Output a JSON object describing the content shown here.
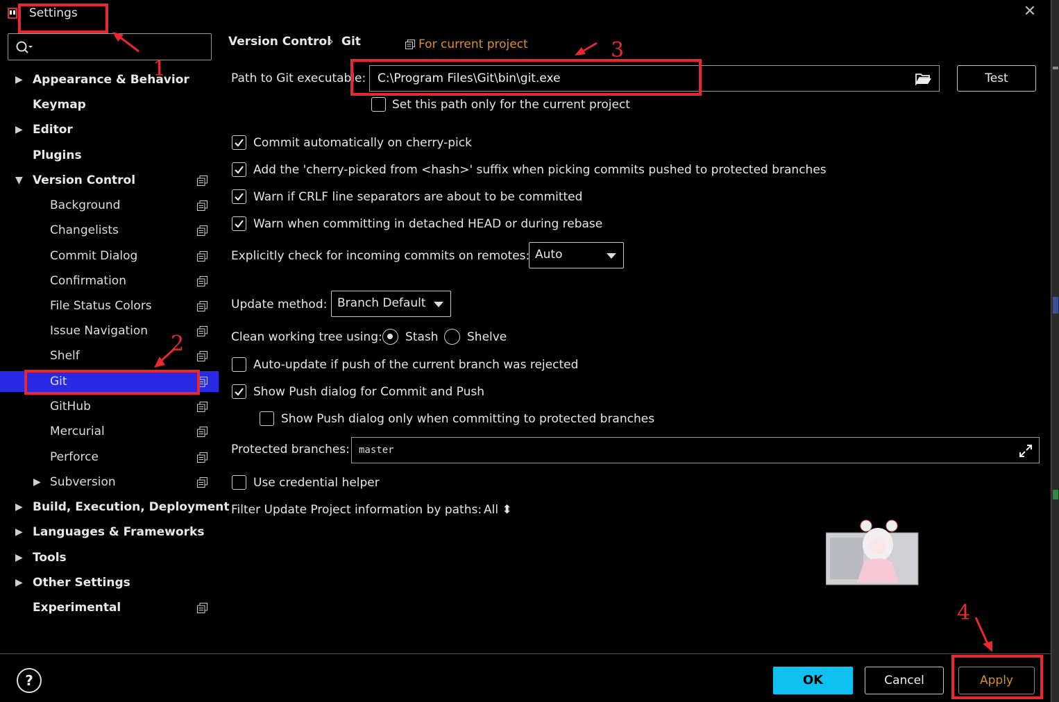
{
  "window": {
    "title": "Settings",
    "close_glyph": "✕"
  },
  "search": {
    "placeholder": "",
    "icon": "search-icon"
  },
  "sidebar": {
    "items": [
      {
        "label": "Appearance & Behavior",
        "level": 0,
        "expandable": true,
        "expanded": false,
        "project_icon": false
      },
      {
        "label": "Keymap",
        "level": 0,
        "expandable": false,
        "project_icon": false
      },
      {
        "label": "Editor",
        "level": 0,
        "expandable": true,
        "expanded": false,
        "project_icon": false
      },
      {
        "label": "Plugins",
        "level": 0,
        "expandable": false,
        "project_icon": false
      },
      {
        "label": "Version Control",
        "level": 0,
        "expandable": true,
        "expanded": true,
        "project_icon": true
      },
      {
        "label": "Background",
        "level": 1,
        "project_icon": true
      },
      {
        "label": "Changelists",
        "level": 1,
        "project_icon": true
      },
      {
        "label": "Commit Dialog",
        "level": 1,
        "project_icon": true
      },
      {
        "label": "Confirmation",
        "level": 1,
        "project_icon": true
      },
      {
        "label": "File Status Colors",
        "level": 1,
        "project_icon": true
      },
      {
        "label": "Issue Navigation",
        "level": 1,
        "project_icon": true
      },
      {
        "label": "Shelf",
        "level": 1,
        "project_icon": true
      },
      {
        "label": "Git",
        "level": 1,
        "project_icon": true,
        "selected": true
      },
      {
        "label": "GitHub",
        "level": 1,
        "project_icon": true
      },
      {
        "label": "Mercurial",
        "level": 1,
        "project_icon": true
      },
      {
        "label": "Perforce",
        "level": 1,
        "project_icon": true
      },
      {
        "label": "Subversion",
        "level": 1,
        "expandable": true,
        "expanded": false,
        "project_icon": true
      },
      {
        "label": "Build, Execution, Deployment",
        "level": 0,
        "expandable": true,
        "expanded": false,
        "project_icon": false
      },
      {
        "label": "Languages & Frameworks",
        "level": 0,
        "expandable": true,
        "expanded": false,
        "project_icon": false
      },
      {
        "label": "Tools",
        "level": 0,
        "expandable": true,
        "expanded": false,
        "project_icon": false
      },
      {
        "label": "Other Settings",
        "level": 0,
        "expandable": true,
        "expanded": false,
        "project_icon": false
      },
      {
        "label": "Experimental",
        "level": 0,
        "expandable": false,
        "project_icon": true
      }
    ]
  },
  "breadcrumb": {
    "parent": "Version Control",
    "separator": "›",
    "current": "Git",
    "scope_label": "For current project"
  },
  "git": {
    "path_label": "Path to Git executable:",
    "path_value": "C:\\Program Files\\Git\\bin\\git.exe",
    "test_label": "Test",
    "path_current_project_label": "Set this path only for the current project",
    "cherry_pick_label": "Commit automatically on cherry-pick",
    "cherry_suffix_label": "Add the 'cherry-picked from <hash>' suffix when picking commits pushed to protected branches",
    "crlf_label": "Warn if CRLF line separators are about to be committed",
    "detached_label": "Warn when committing in detached HEAD or during rebase",
    "incoming_label": "Explicitly check for incoming commits on remotes:",
    "incoming_value": "Auto",
    "update_method_label": "Update method:",
    "update_method_value": "Branch Default",
    "clean_tree_label": "Clean working tree using:",
    "stash_label": "Stash",
    "shelve_label": "Shelve",
    "auto_update_label": "Auto-update if push of the current branch was rejected",
    "show_push_label": "Show Push dialog for Commit and Push",
    "show_push_protected_label": "Show Push dialog only when committing to protected branches",
    "protected_label": "Protected branches:",
    "protected_value": "master",
    "credential_label": "Use credential helper",
    "filter_label": "Filter Update Project information by paths:",
    "filter_value": "All ⬍"
  },
  "checkboxes": {
    "path_current_project": false,
    "cherry_pick": true,
    "cherry_suffix": true,
    "crlf": true,
    "detached": true,
    "auto_update": false,
    "show_push": true,
    "show_push_protected": false,
    "credential": false
  },
  "clean_tree_selected": "Stash",
  "annotations": [
    "1",
    "2",
    "3",
    "4"
  ],
  "footer": {
    "help": "?",
    "ok": "OK",
    "cancel": "Cancel",
    "apply": "Apply"
  },
  "colors": {
    "selection": "#2a2ae6",
    "ok_button": "#0ec1f0",
    "accent_orange": "#d8902c",
    "annotation_red": "#e8282e"
  }
}
